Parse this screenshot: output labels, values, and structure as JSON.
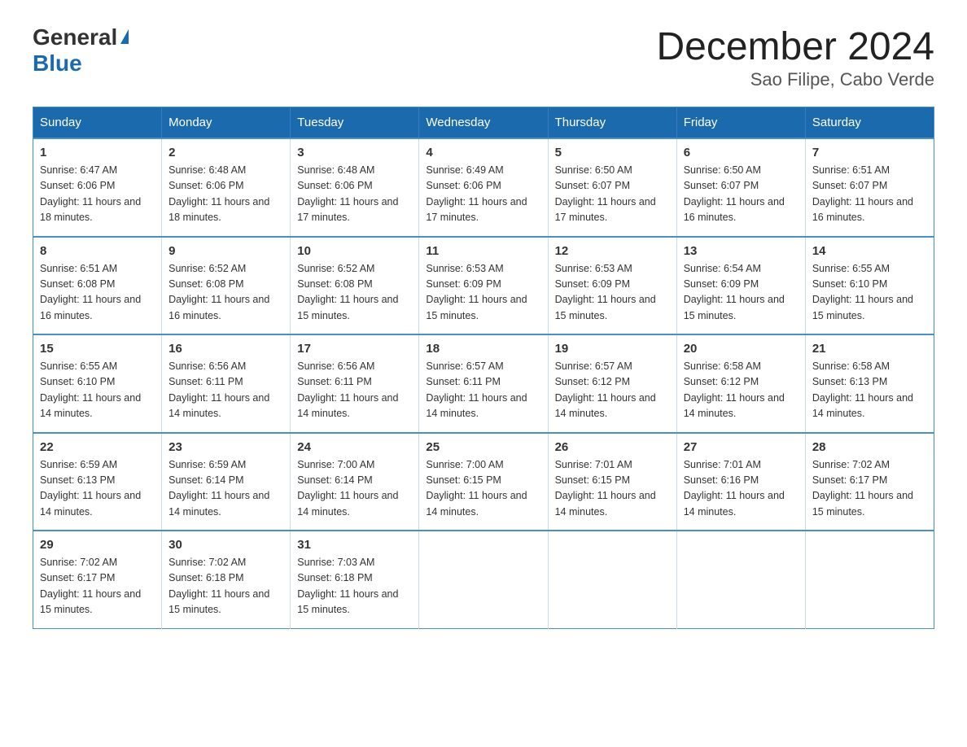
{
  "logo": {
    "general": "General",
    "blue": "Blue"
  },
  "title": "December 2024",
  "subtitle": "Sao Filipe, Cabo Verde",
  "days_header": [
    "Sunday",
    "Monday",
    "Tuesday",
    "Wednesday",
    "Thursday",
    "Friday",
    "Saturday"
  ],
  "weeks": [
    [
      {
        "day": "1",
        "sunrise": "6:47 AM",
        "sunset": "6:06 PM",
        "daylight": "11 hours and 18 minutes."
      },
      {
        "day": "2",
        "sunrise": "6:48 AM",
        "sunset": "6:06 PM",
        "daylight": "11 hours and 18 minutes."
      },
      {
        "day": "3",
        "sunrise": "6:48 AM",
        "sunset": "6:06 PM",
        "daylight": "11 hours and 17 minutes."
      },
      {
        "day": "4",
        "sunrise": "6:49 AM",
        "sunset": "6:06 PM",
        "daylight": "11 hours and 17 minutes."
      },
      {
        "day": "5",
        "sunrise": "6:50 AM",
        "sunset": "6:07 PM",
        "daylight": "11 hours and 17 minutes."
      },
      {
        "day": "6",
        "sunrise": "6:50 AM",
        "sunset": "6:07 PM",
        "daylight": "11 hours and 16 minutes."
      },
      {
        "day": "7",
        "sunrise": "6:51 AM",
        "sunset": "6:07 PM",
        "daylight": "11 hours and 16 minutes."
      }
    ],
    [
      {
        "day": "8",
        "sunrise": "6:51 AM",
        "sunset": "6:08 PM",
        "daylight": "11 hours and 16 minutes."
      },
      {
        "day": "9",
        "sunrise": "6:52 AM",
        "sunset": "6:08 PM",
        "daylight": "11 hours and 16 minutes."
      },
      {
        "day": "10",
        "sunrise": "6:52 AM",
        "sunset": "6:08 PM",
        "daylight": "11 hours and 15 minutes."
      },
      {
        "day": "11",
        "sunrise": "6:53 AM",
        "sunset": "6:09 PM",
        "daylight": "11 hours and 15 minutes."
      },
      {
        "day": "12",
        "sunrise": "6:53 AM",
        "sunset": "6:09 PM",
        "daylight": "11 hours and 15 minutes."
      },
      {
        "day": "13",
        "sunrise": "6:54 AM",
        "sunset": "6:09 PM",
        "daylight": "11 hours and 15 minutes."
      },
      {
        "day": "14",
        "sunrise": "6:55 AM",
        "sunset": "6:10 PM",
        "daylight": "11 hours and 15 minutes."
      }
    ],
    [
      {
        "day": "15",
        "sunrise": "6:55 AM",
        "sunset": "6:10 PM",
        "daylight": "11 hours and 14 minutes."
      },
      {
        "day": "16",
        "sunrise": "6:56 AM",
        "sunset": "6:11 PM",
        "daylight": "11 hours and 14 minutes."
      },
      {
        "day": "17",
        "sunrise": "6:56 AM",
        "sunset": "6:11 PM",
        "daylight": "11 hours and 14 minutes."
      },
      {
        "day": "18",
        "sunrise": "6:57 AM",
        "sunset": "6:11 PM",
        "daylight": "11 hours and 14 minutes."
      },
      {
        "day": "19",
        "sunrise": "6:57 AM",
        "sunset": "6:12 PM",
        "daylight": "11 hours and 14 minutes."
      },
      {
        "day": "20",
        "sunrise": "6:58 AM",
        "sunset": "6:12 PM",
        "daylight": "11 hours and 14 minutes."
      },
      {
        "day": "21",
        "sunrise": "6:58 AM",
        "sunset": "6:13 PM",
        "daylight": "11 hours and 14 minutes."
      }
    ],
    [
      {
        "day": "22",
        "sunrise": "6:59 AM",
        "sunset": "6:13 PM",
        "daylight": "11 hours and 14 minutes."
      },
      {
        "day": "23",
        "sunrise": "6:59 AM",
        "sunset": "6:14 PM",
        "daylight": "11 hours and 14 minutes."
      },
      {
        "day": "24",
        "sunrise": "7:00 AM",
        "sunset": "6:14 PM",
        "daylight": "11 hours and 14 minutes."
      },
      {
        "day": "25",
        "sunrise": "7:00 AM",
        "sunset": "6:15 PM",
        "daylight": "11 hours and 14 minutes."
      },
      {
        "day": "26",
        "sunrise": "7:01 AM",
        "sunset": "6:15 PM",
        "daylight": "11 hours and 14 minutes."
      },
      {
        "day": "27",
        "sunrise": "7:01 AM",
        "sunset": "6:16 PM",
        "daylight": "11 hours and 14 minutes."
      },
      {
        "day": "28",
        "sunrise": "7:02 AM",
        "sunset": "6:17 PM",
        "daylight": "11 hours and 15 minutes."
      }
    ],
    [
      {
        "day": "29",
        "sunrise": "7:02 AM",
        "sunset": "6:17 PM",
        "daylight": "11 hours and 15 minutes."
      },
      {
        "day": "30",
        "sunrise": "7:02 AM",
        "sunset": "6:18 PM",
        "daylight": "11 hours and 15 minutes."
      },
      {
        "day": "31",
        "sunrise": "7:03 AM",
        "sunset": "6:18 PM",
        "daylight": "11 hours and 15 minutes."
      },
      null,
      null,
      null,
      null
    ]
  ]
}
